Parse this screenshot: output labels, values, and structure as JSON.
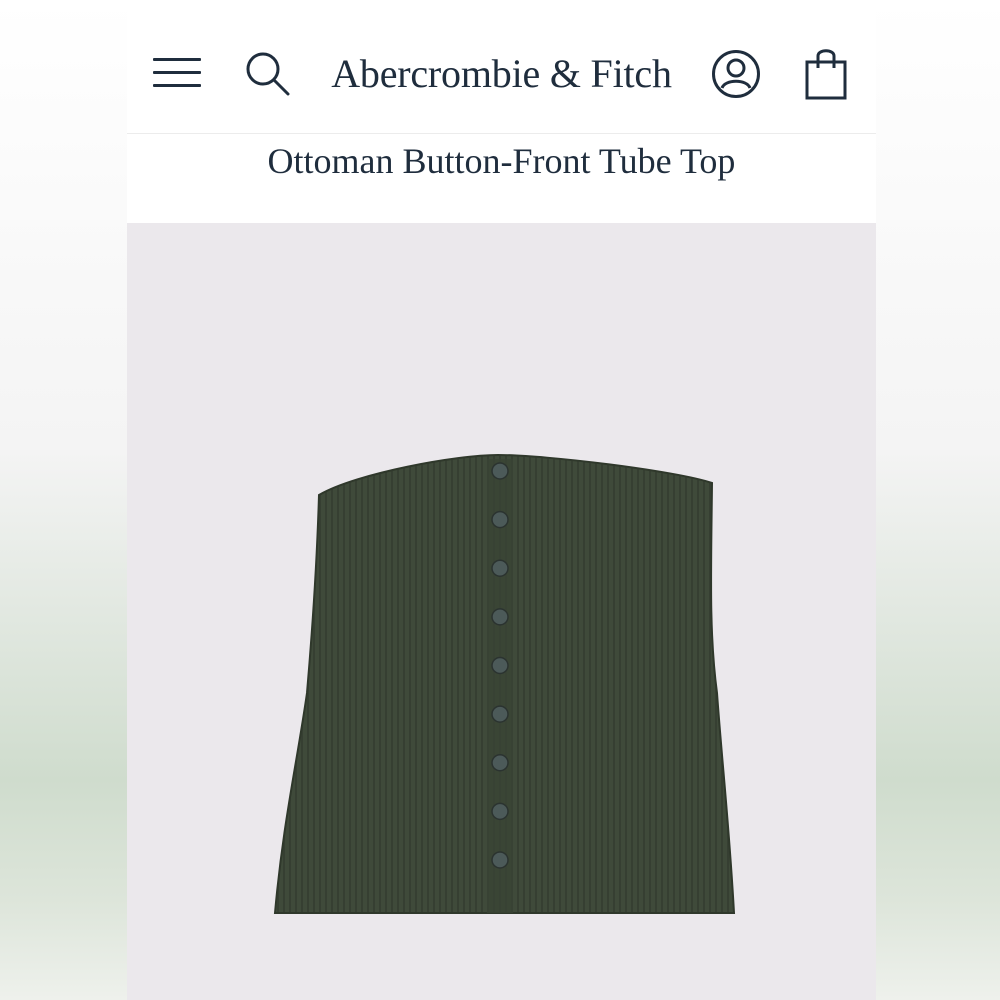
{
  "header": {
    "brand": "Abercrombie & Fitch",
    "icons": [
      "hamburger-menu-icon",
      "search-icon",
      "account-icon",
      "shopping-bag-icon"
    ]
  },
  "product": {
    "title": "Ottoman Button-Front Tube Top",
    "color": "#3f4a3a",
    "button_count": 9
  },
  "colors": {
    "text": "#1f2d3d",
    "background": "#ebe8ec"
  }
}
